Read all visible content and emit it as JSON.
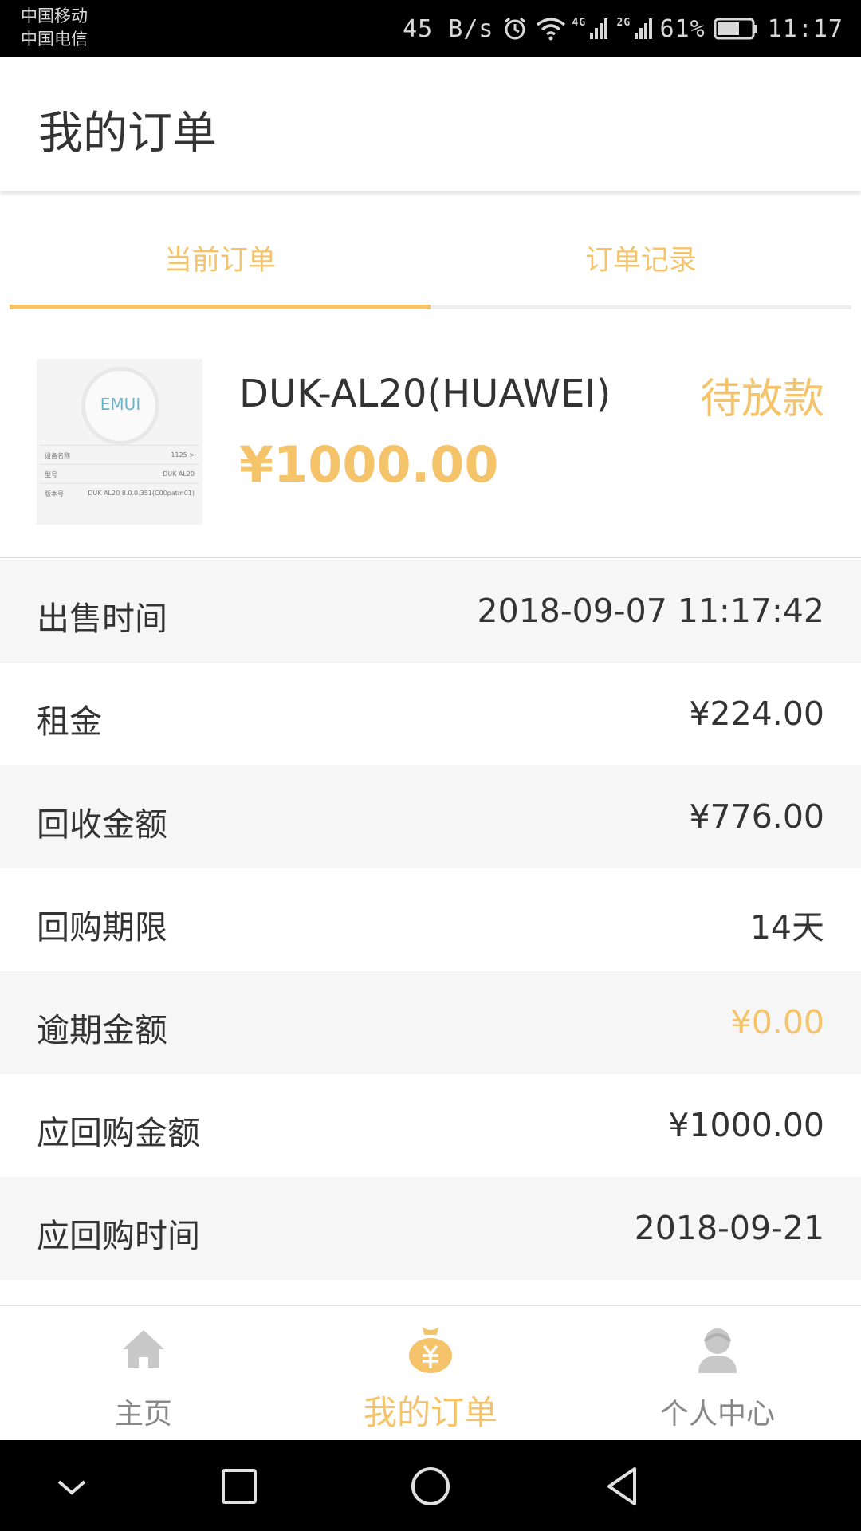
{
  "status_bar": {
    "carrier_1": "中国移动",
    "carrier_2": "中国电信",
    "net_speed": "45 B/s",
    "network_1": "4G",
    "network_2": "2G",
    "battery": "61%",
    "time": "11:17",
    "icons": [
      "alarm-icon",
      "wifi-icon",
      "signal-icon",
      "battery-icon"
    ]
  },
  "header": {
    "title": "我的订单"
  },
  "tabs": [
    {
      "label": "当前订单",
      "active": true
    },
    {
      "label": "订单记录",
      "active": false
    }
  ],
  "product": {
    "name": "DUK-AL20(HUAWEI)",
    "price": "¥1000.00",
    "status": "待放款",
    "thumbnail": {
      "logo": "EMUI",
      "rows": [
        {
          "label": "设备名称",
          "value": "1125 >"
        },
        {
          "label": "型号",
          "value": "DUK AL20"
        },
        {
          "label": "版本号",
          "value": "DUK AL20 8.0.0.351(C00patm01)"
        }
      ]
    }
  },
  "details": [
    {
      "label": "出售时间",
      "value": "2018-09-07 11:17:42",
      "highlight": false
    },
    {
      "label": "租金",
      "value": "¥224.00",
      "highlight": false
    },
    {
      "label": "回收金额",
      "value": "¥776.00",
      "highlight": false
    },
    {
      "label": "回购期限",
      "value": "14天",
      "highlight": false
    },
    {
      "label": "逾期金额",
      "value": "¥0.00",
      "highlight": true
    },
    {
      "label": "应回购金额",
      "value": "¥1000.00",
      "highlight": false
    },
    {
      "label": "应回购时间",
      "value": "2018-09-21",
      "highlight": false
    }
  ],
  "bottom_nav": [
    {
      "label": "主页",
      "icon": "home-icon",
      "active": false
    },
    {
      "label": "我的订单",
      "icon": "money-bag-icon",
      "active": true
    },
    {
      "label": "个人中心",
      "icon": "user-icon",
      "active": false
    }
  ],
  "system_nav": [
    "chevron-down-icon",
    "recent-apps-icon",
    "home-circle-icon",
    "back-icon"
  ],
  "colors": {
    "accent": "#f5c36a",
    "text": "#333333",
    "muted": "#888888",
    "row_alt": "#f6f6f6"
  }
}
